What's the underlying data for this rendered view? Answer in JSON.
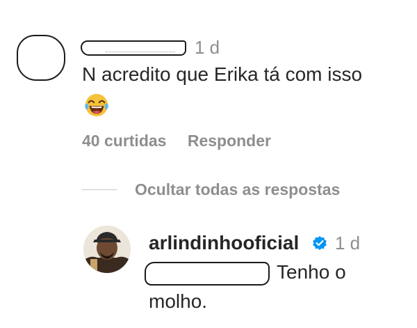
{
  "comment": {
    "time": "1 d",
    "text": "N acredito que Erika tá com isso",
    "emoji": "face-with-tears-of-joy",
    "likes": "40 curtidas",
    "reply_label": "Responder"
  },
  "thread": {
    "hide_replies_label": "Ocultar todas as respostas"
  },
  "reply": {
    "username": "arlindinhooficial",
    "verified": true,
    "time": "1 d",
    "text_line1": "Tenho o",
    "text_line2": "molho."
  },
  "colors": {
    "text": "#262626",
    "secondary": "#8e8e8e",
    "verified_blue": "#0095f6"
  }
}
